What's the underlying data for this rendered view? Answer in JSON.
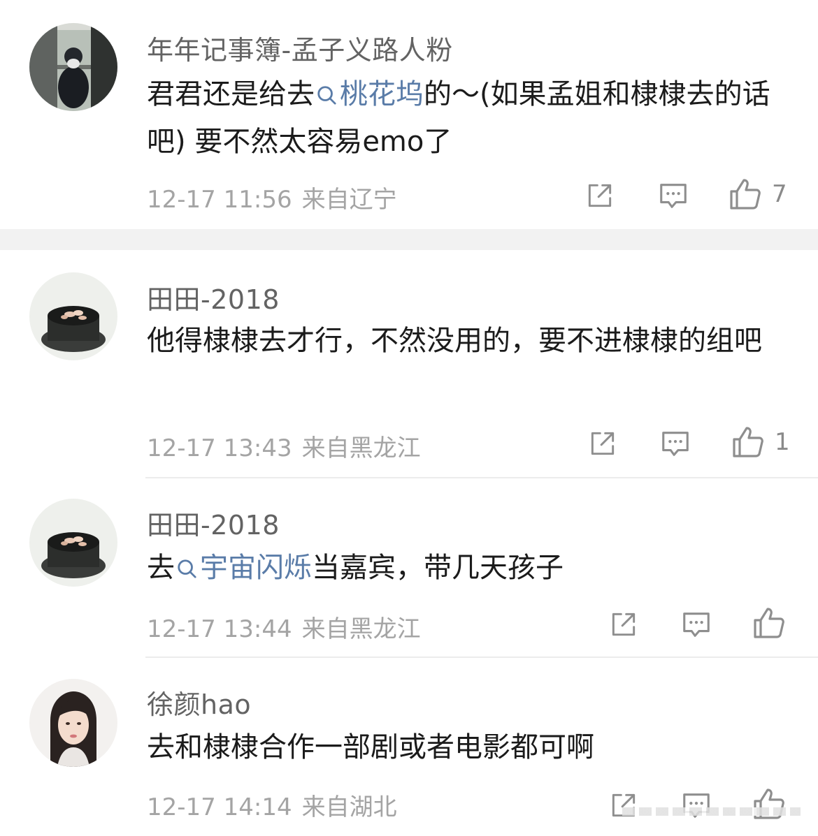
{
  "comments": [
    {
      "username": "年年记事簿-孟子义路人粉",
      "text_before": "君君还是给去",
      "topic": "桃花坞",
      "text_after": "的～(如果孟姐和棣棣去的话吧) 要不然太容易emo了",
      "time": "12-17 11:56",
      "location": "来自辽宁",
      "likes": "7",
      "avatar": "avatar-person-window"
    },
    {
      "username": "田田-2018",
      "text_before": "他得棣棣去才行，不然没用的，要不进棣棣的组吧",
      "topic": "",
      "text_after": "",
      "time": "12-17 13:43",
      "location": "来自黑龙江",
      "likes": "1",
      "avatar": "avatar-flower-bowl"
    },
    {
      "username": "田田-2018",
      "text_before": "去",
      "topic": "宇宙闪烁",
      "text_after": "当嘉宾，带几天孩子",
      "time": "12-17 13:44",
      "location": "来自黑龙江",
      "likes": "",
      "avatar": "avatar-flower-bowl"
    },
    {
      "username": "徐颜hao",
      "text_before": "去和棣棣合作一部剧或者电影都可啊",
      "topic": "",
      "text_after": "",
      "time": "12-17 14:14",
      "location": "来自湖北",
      "likes": "",
      "avatar": "avatar-woman-portrait"
    }
  ],
  "icons": {
    "share": "share-icon",
    "comment": "comment-icon",
    "like": "thumbs-up-icon",
    "topic": "search-icon"
  },
  "colors": {
    "topic_link": "#5a7ca8",
    "username": "#636363",
    "meta": "#a4a4a4",
    "body_text": "#1b1b1b",
    "section_band": "#f2f2f2"
  }
}
